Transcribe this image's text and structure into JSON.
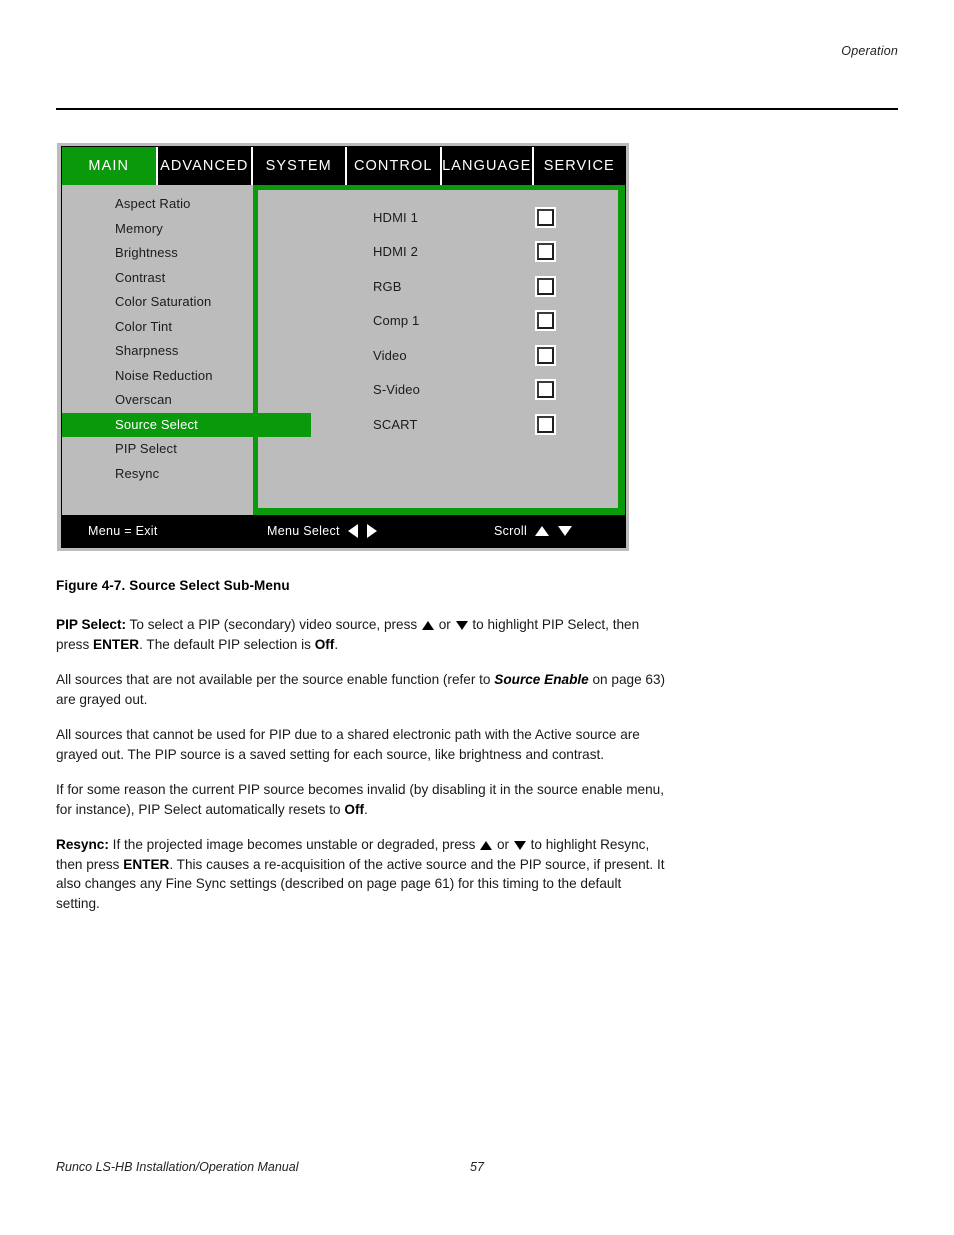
{
  "header": {
    "section": "Operation"
  },
  "osd": {
    "tabs": [
      {
        "label": "MAIN",
        "active": true
      },
      {
        "label": "ADVANCED",
        "active": false
      },
      {
        "label": "SYSTEM",
        "active": false
      },
      {
        "label": "CONTROL",
        "active": false
      },
      {
        "label": "LANGUAGE",
        "active": false
      },
      {
        "label": "SERVICE",
        "active": false
      }
    ],
    "menu_items": [
      {
        "label": "Aspect Ratio",
        "selected": false
      },
      {
        "label": "Memory",
        "selected": false
      },
      {
        "label": "Brightness",
        "selected": false
      },
      {
        "label": "Contrast",
        "selected": false
      },
      {
        "label": "Color Saturation",
        "selected": false
      },
      {
        "label": "Color Tint",
        "selected": false
      },
      {
        "label": "Sharpness",
        "selected": false
      },
      {
        "label": "Noise Reduction",
        "selected": false
      },
      {
        "label": "Overscan",
        "selected": false
      },
      {
        "label": "Source Select",
        "selected": true
      },
      {
        "label": "PIP Select",
        "selected": false
      },
      {
        "label": "Resync",
        "selected": false
      }
    ],
    "sources": [
      {
        "label": "HDMI 1",
        "checked": false
      },
      {
        "label": "HDMI 2",
        "checked": false
      },
      {
        "label": "RGB",
        "checked": false
      },
      {
        "label": "Comp 1",
        "checked": false
      },
      {
        "label": "Video",
        "checked": false
      },
      {
        "label": "S-Video",
        "checked": false
      },
      {
        "label": "SCART",
        "checked": false
      }
    ],
    "statusbar": {
      "exit": "Menu = Exit",
      "select": "Menu Select",
      "scroll": "Scroll"
    },
    "colors": {
      "highlight_green": "#09990a",
      "panel_gray": "#bcbcbc",
      "bar_black": "#000000"
    }
  },
  "document": {
    "figure_caption": "Figure 4-7. Source Select Sub-Menu",
    "paragraphs": {
      "pip_select": {
        "lead": "PIP Select:",
        "text_1": " To select a PIP (secondary) video source, press ",
        "text_2": " or ",
        "text_3": " to highlight PIP Select, then press ",
        "bold_enter": "ENTER",
        "text_4": ". The default PIP selection is ",
        "bold_off": "Off",
        "text_5": "."
      },
      "grayed_sources": {
        "text_1": "All sources that are not available per the source enable function (refer to ",
        "bolditalic_ref": "Source Enable",
        "text_2": " on page 63) are grayed out."
      },
      "shared_path": {
        "text": "All sources that cannot be used for PIP due to a shared electronic path with the Active source are grayed out. The PIP source is a saved setting for each source, like brightness and contrast."
      },
      "invalid_reset": {
        "text_1": "If for some reason the current PIP source becomes invalid (by disabling it in the source enable menu, for instance), PIP Select automatically resets to ",
        "bold_off": "Off",
        "text_2": "."
      },
      "resync": {
        "lead": "Resync:",
        "text_1": " If the projected image becomes unstable or degraded, press ",
        "text_2": " or ",
        "text_3": " to highlight Resync, then press ",
        "bold_enter": "ENTER",
        "text_4": ". This causes a re-acquisition of the active source and the PIP source, if present. It also changes any Fine Sync settings (described on page page 61) for this timing to the default setting."
      }
    }
  },
  "footer": {
    "title": "Runco LS-HB Installation/Operation Manual",
    "page_number": "57"
  }
}
